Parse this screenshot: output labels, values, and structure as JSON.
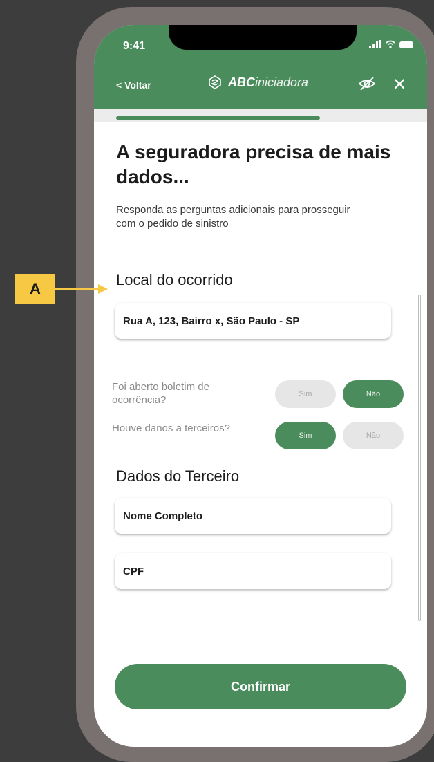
{
  "status_bar": {
    "time": "9:41"
  },
  "header": {
    "back_label": "< Voltar",
    "brand_bold": "ABC",
    "brand_light": "iniciadora",
    "progress": 0.72,
    "color": "#4a8c5c"
  },
  "main": {
    "title": "A seguradora precisa de mais dados...",
    "subtitle": "Responda as perguntas adicionais para prosseguir com o pedido de sinistro",
    "location": {
      "heading": "Local do ocorrido",
      "value": "Rua A, 123, Bairro x, São Paulo - SP"
    },
    "questions": [
      {
        "text": "Foi aberto boletim de ocorrência?",
        "yes_label": "Sim",
        "no_label": "Não",
        "selected": "Não"
      },
      {
        "text": "Houve danos a terceiros?",
        "yes_label": "Sim",
        "no_label": "Não",
        "selected": "Sim"
      }
    ],
    "third_party": {
      "heading": "Dados do Terceiro",
      "name_placeholder": "Nome Completo",
      "cpf_placeholder": "CPF"
    },
    "confirm_label": "Confirmar"
  },
  "annotation": {
    "label": "A",
    "color": "#f7c844"
  },
  "icons": [
    "chevron-left-icon",
    "brand-logo-icon",
    "eye-off-icon",
    "close-icon",
    "signal-icon",
    "wifi-icon",
    "battery-icon"
  ]
}
